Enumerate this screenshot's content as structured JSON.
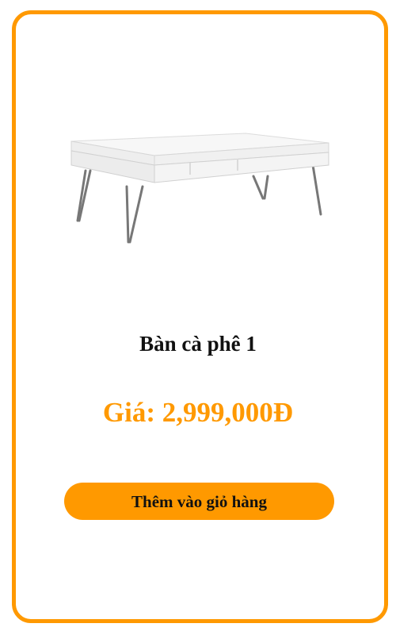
{
  "product": {
    "name": "Bàn cà phê 1",
    "price_label": "Giá:",
    "price_value": "2,999,000Đ",
    "image_icon": "coffee-table-image"
  },
  "actions": {
    "add_to_cart_label": "Thêm vào giỏ hàng"
  },
  "colors": {
    "accent": "#ff9900",
    "text": "#111111",
    "background": "#ffffff"
  }
}
